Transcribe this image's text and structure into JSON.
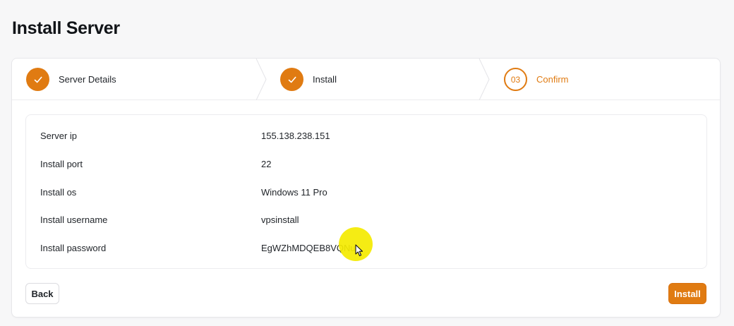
{
  "page": {
    "title": "Install Server"
  },
  "stepper": {
    "steps": [
      {
        "label": "Server Details",
        "status": "complete",
        "icon": "check-icon"
      },
      {
        "label": "Install",
        "status": "complete",
        "icon": "check-icon"
      },
      {
        "number": "03",
        "label": "Confirm",
        "status": "current"
      }
    ]
  },
  "details": {
    "rows": [
      {
        "label": "Server ip",
        "value": "155.138.238.151"
      },
      {
        "label": "Install port",
        "value": "22"
      },
      {
        "label": "Install os",
        "value": "Windows 11 Pro"
      },
      {
        "label": "Install username",
        "value": "vpsinstall"
      },
      {
        "label": "Install password",
        "value": "EgWZhMDQEB8VQNu"
      }
    ]
  },
  "actions": {
    "back_label": "Back",
    "install_label": "Install"
  },
  "colors": {
    "accent": "#e07b12",
    "highlight": "#f4ea00"
  }
}
